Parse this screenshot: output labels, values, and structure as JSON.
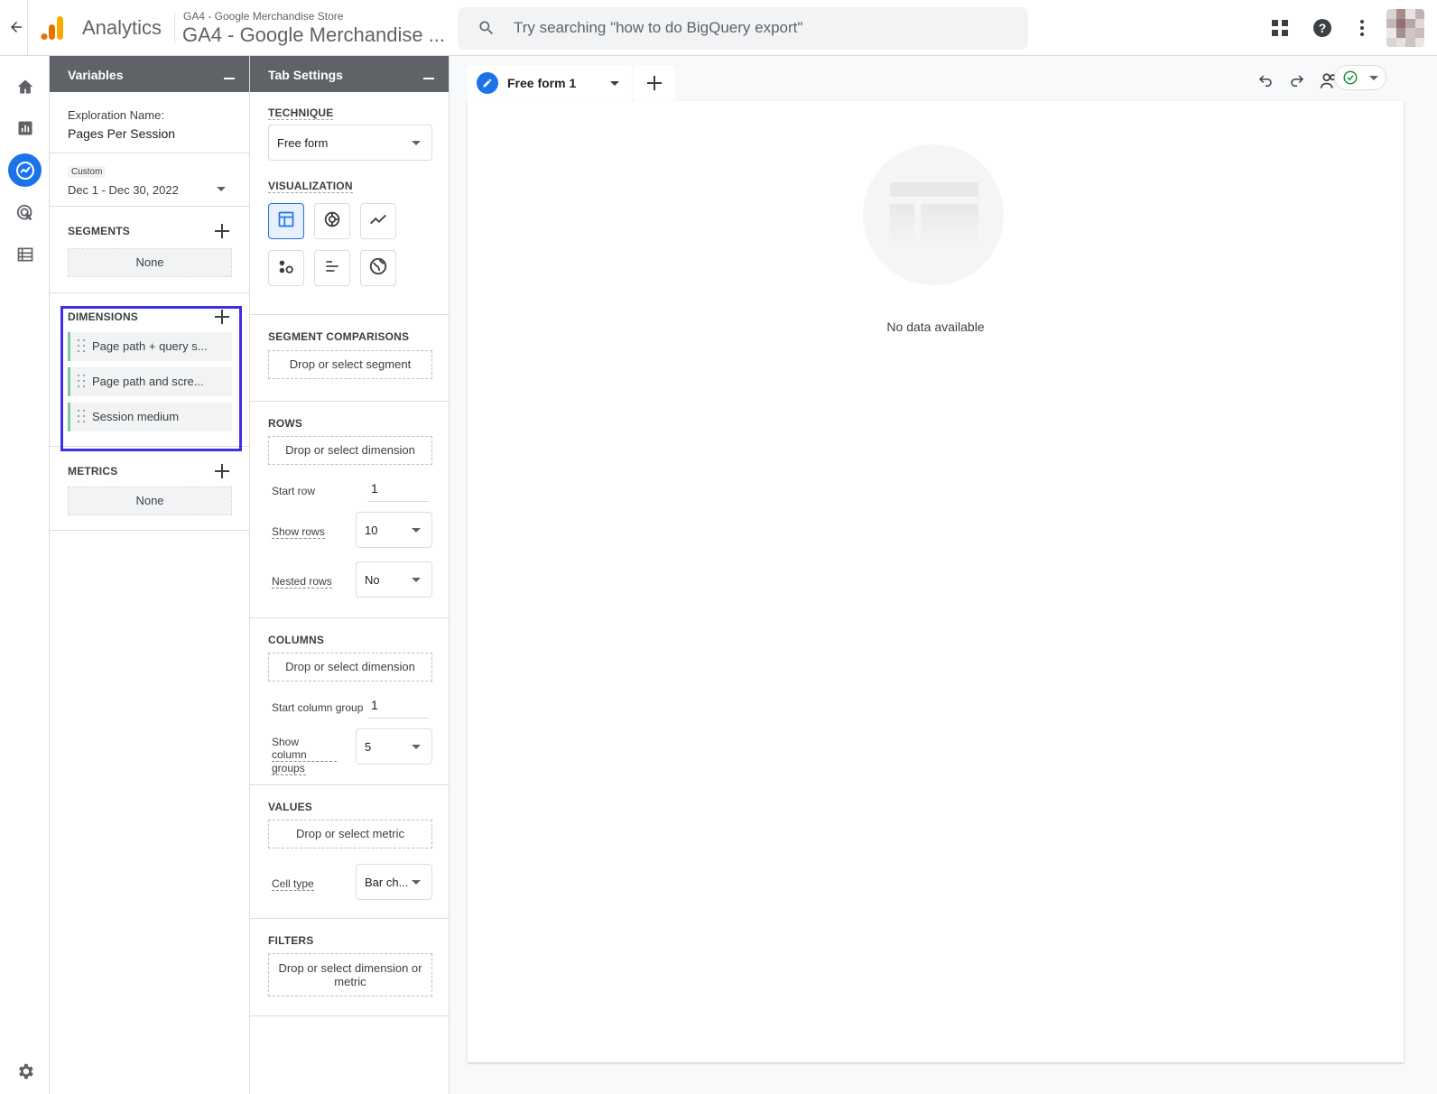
{
  "header": {
    "app_name": "Analytics",
    "property_account": "GA4 - Google Merchandise Store",
    "property_name": "GA4 - Google Merchandise ...",
    "search_placeholder": "Try searching \"how to do BigQuery export\""
  },
  "left_nav": {
    "items": [
      "home-icon",
      "reports-icon",
      "explore-icon",
      "advertising-icon",
      "configure-icon"
    ],
    "active": "explore-icon",
    "footer": "settings-icon"
  },
  "variables": {
    "title": "Variables",
    "exploration_name_label": "Exploration Name:",
    "exploration_name": "Pages Per Session",
    "date_badge": "Custom",
    "date_range": "Dec 1 - Dec 30, 2022",
    "segments_title": "SEGMENTS",
    "segments_none": "None",
    "dimensions_title": "DIMENSIONS",
    "dimensions": [
      {
        "label": "Page path + query s..."
      },
      {
        "label": "Page path and scre..."
      },
      {
        "label": "Session medium"
      }
    ],
    "metrics_title": "METRICS",
    "metrics_none": "None"
  },
  "tab_settings": {
    "title": "Tab Settings",
    "technique_label": "TECHNIQUE",
    "technique_value": "Free form",
    "visualization_label": "VISUALIZATION",
    "visualization_options": [
      "table-icon",
      "donut-chart-icon",
      "line-chart-icon",
      "scatter-plot-icon",
      "bar-chart-icon",
      "geo-map-icon"
    ],
    "visualization_selected": "table-icon",
    "segment_comparisons_label": "SEGMENT COMPARISONS",
    "segment_drop": "Drop or select segment",
    "rows_label": "ROWS",
    "rows_drop": "Drop or select dimension",
    "start_row_label": "Start row",
    "start_row_value": "1",
    "show_rows_label": "Show rows",
    "show_rows_value": "10",
    "nested_rows_label": "Nested rows",
    "nested_rows_value": "No",
    "columns_label": "COLUMNS",
    "columns_drop": "Drop or select dimension",
    "start_column_group_label": "Start column group",
    "start_column_group_value": "1",
    "show_column_groups_label_line1": "Show column",
    "show_column_groups_label_line2": "groups",
    "show_column_groups_value": "5",
    "values_label": "VALUES",
    "values_drop": "Drop or select metric",
    "cell_type_label": "Cell type",
    "cell_type_value": "Bar ch...",
    "filters_label": "FILTERS",
    "filters_drop_line1": "Drop or select dimension or",
    "filters_drop_line2": "metric"
  },
  "main": {
    "tab_label": "Free form 1",
    "empty_message": "No data available"
  },
  "colors": {
    "accent": "#1a73e8",
    "panel_header": "#5f6368",
    "highlight_box": "#3f2ee6",
    "dimension_bar": "#81c995",
    "logo_orange": "#f9ab00",
    "logo_dark_orange": "#e37400"
  }
}
